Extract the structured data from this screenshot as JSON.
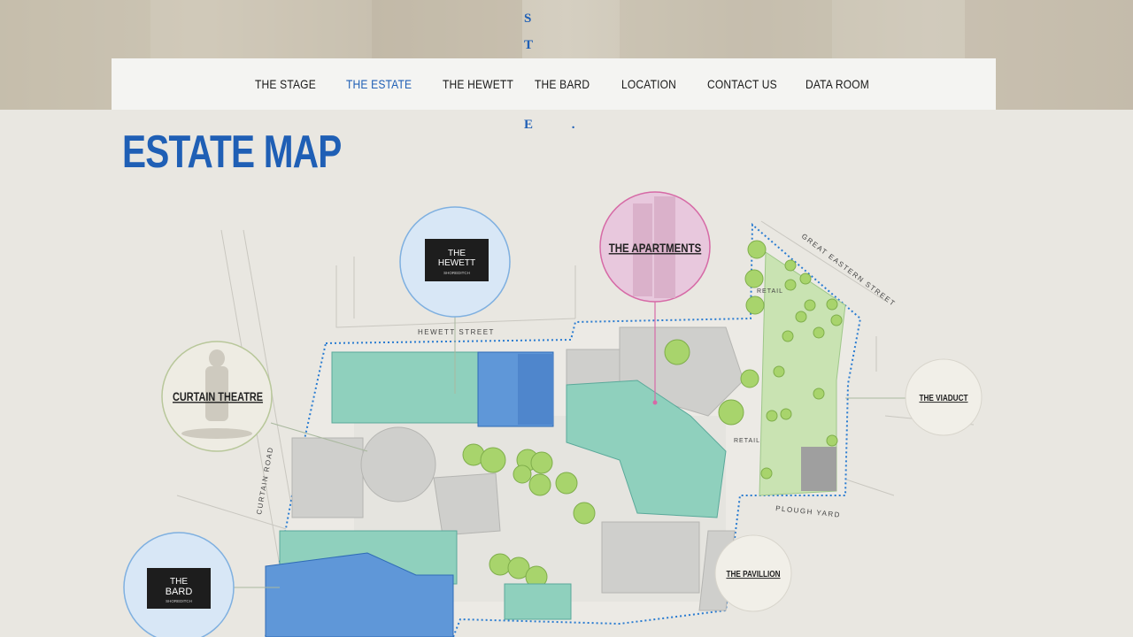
{
  "logo": {
    "line1": "S T A",
    "line2": "G E ."
  },
  "nav": {
    "items": [
      {
        "label": "THE STAGE",
        "active": false
      },
      {
        "label": "THE ESTATE",
        "active": true
      },
      {
        "label": "THE HEWETT",
        "active": false
      },
      {
        "label": "THE BARD",
        "active": false
      },
      {
        "label": "LOCATION",
        "active": false
      },
      {
        "label": "CONTACT US",
        "active": false
      },
      {
        "label": "DATA ROOM",
        "active": false
      }
    ]
  },
  "page": {
    "title": "ESTATE MAP"
  },
  "map": {
    "bubbles": {
      "hewett": {
        "line1": "THE",
        "line2": "HEWETT",
        "line3": "SHOREDITCH"
      },
      "apartments": {
        "label": "THE APARTMENTS"
      },
      "curtain_theatre": {
        "label": "CURTAIN THEATRE"
      },
      "viaduct": {
        "label": "THE VIADUCT"
      },
      "pavillion": {
        "label": "THE PAVILLION"
      },
      "bard": {
        "line1": "THE",
        "line2": "BARD",
        "line3": "SHOREDITCH"
      }
    },
    "streets": {
      "hewett_street": "HEWETT STREET",
      "great_eastern_street": "GREAT EASTERN STREET",
      "curtain_road": "CURTAIN ROAD",
      "plough_yard": "PLOUGH YARD",
      "retail_1": "RETAIL",
      "retail_2": "RETAIL"
    }
  },
  "colors": {
    "accent": "#1f5fb5",
    "teal": "#8fd0bd",
    "blue_block": "#5f97d8",
    "green_trees": "#a8d46c",
    "apartments_pink": "#d66aa6"
  }
}
